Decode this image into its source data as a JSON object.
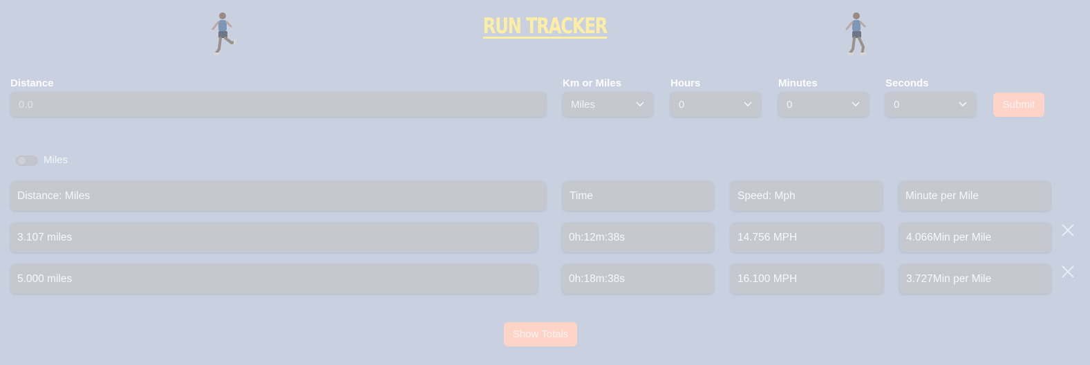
{
  "header": {
    "title": "RUN TRACKER",
    "left_image": "runner-illustration",
    "right_image": "runner-illustration"
  },
  "form": {
    "distance": {
      "label": "Distance",
      "placeholder": "0.0",
      "value": ""
    },
    "unit": {
      "label": "Km or Miles",
      "value": "Miles"
    },
    "hours": {
      "label": "Hours",
      "value": "0"
    },
    "minutes": {
      "label": "Minutes",
      "value": "0"
    },
    "seconds": {
      "label": "Seconds",
      "value": "0"
    },
    "submit_label": "Submit"
  },
  "unit_toggle": {
    "label": "Miles",
    "on": false
  },
  "table": {
    "headers": [
      "Distance: Miles",
      "Time",
      "Speed: Mph",
      "Minute per Mile"
    ],
    "rows": [
      [
        "3.107 miles",
        "0h:12m:38s",
        "14.756 MPH",
        "4.066Min per Mile"
      ],
      [
        "5.000 miles",
        "0h:18m:38s",
        "16.100 MPH",
        "3.727Min per Mile"
      ]
    ],
    "row_action_icon": "close-icon"
  },
  "show_totals_label": "Show Totals",
  "colors": {
    "background": "#c9d1e1",
    "title": "#fdeea6",
    "accent_button": "#fed3c8",
    "field": "#c6c8cf"
  }
}
